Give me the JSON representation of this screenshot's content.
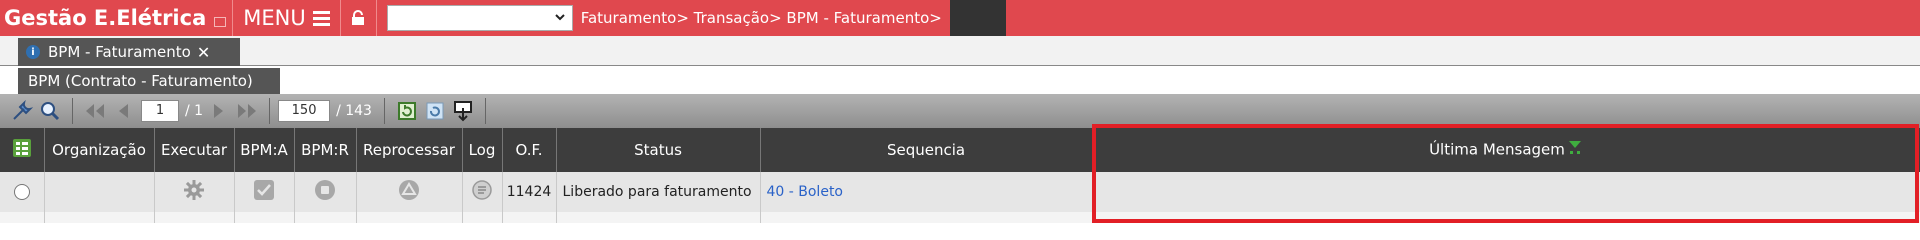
{
  "topbar": {
    "brand": "Gestão E.Elétrica",
    "menu_label": "MENU",
    "module_select_value": "",
    "breadcrumb": "Faturamento> Transação> BPM - Faturamento>",
    "accent_color": "#e0484e"
  },
  "tabs": [
    {
      "label": "BPM - Faturamento",
      "close": "✕",
      "icon": "info-icon"
    }
  ],
  "subtab": {
    "label": "BPM (Contrato - Faturamento)"
  },
  "toolbar": {
    "page_current": "1",
    "page_total_text": "/ 1",
    "rows_per_page": "150",
    "rows_total_text": "/ 143",
    "icons": [
      "tools-icon",
      "search-icon",
      "first-page-icon",
      "prev-page-icon",
      "next-page-icon",
      "last-page-icon",
      "refresh-icon",
      "reload-icon",
      "export-icon"
    ]
  },
  "grid": {
    "columns": [
      "",
      "Organização",
      "Executar",
      "BPM:A",
      "BPM:R",
      "Reprocessar",
      "Log",
      "O.F.",
      "Status",
      "Sequencia",
      "Última Mensagem"
    ],
    "rows": [
      {
        "organizacao": "",
        "of": "11424",
        "status": "Liberado para faturamento",
        "sequencia": "40 - Boleto",
        "ultima_mensagem": ""
      }
    ]
  }
}
